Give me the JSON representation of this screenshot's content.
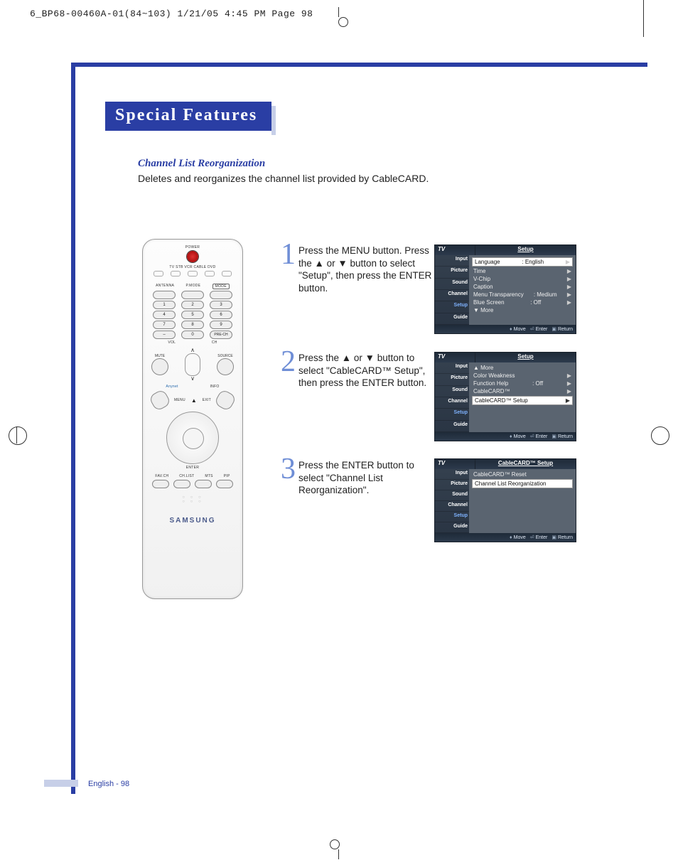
{
  "slug": "6_BP68-00460A-01(84~103)  1/21/05  4:45 PM  Page 98",
  "heading": "Special Features",
  "section_title": "Channel List Reorganization",
  "section_desc": "Deletes and reorganizes the channel list provided by CableCARD.",
  "remote": {
    "power": "POWER",
    "modes": "TV  STB  VCR  CABLE  DVD",
    "row_labels": [
      "ANTENNA",
      "P.MODE",
      "MODE"
    ],
    "num": [
      [
        "1",
        "2",
        "3"
      ],
      [
        "4",
        "5",
        "6"
      ],
      [
        "7",
        "8",
        "9"
      ],
      [
        "–",
        "0",
        "PRE-CH"
      ]
    ],
    "vol": "VOL",
    "ch": "CH",
    "mute": "MUTE",
    "source": "SOURCE",
    "info": "INFO",
    "menu": "MENU",
    "exit": "EXIT",
    "enter": "ENTER",
    "bottom": [
      "FAV.CH",
      "CH.LIST",
      "MTS",
      "PIP"
    ],
    "brand": "SAMSUNG"
  },
  "steps": {
    "s1": {
      "n": "1",
      "t": "Press the MENU button. Press the ▲ or ▼ button to select \"Setup\", then press the ENTER button."
    },
    "s2": {
      "n": "2",
      "t": "Press the ▲ or ▼ button to select \"CableCARD™ Setup\", then press the ENTER button."
    },
    "s3": {
      "n": "3",
      "t": "Press the ENTER button to select \"Channel List Reorganization\"."
    }
  },
  "osd_sidebar": [
    "Input",
    "Picture",
    "Sound",
    "Channel",
    "Setup",
    "Guide"
  ],
  "osd1": {
    "tv": "TV",
    "title": "Setup",
    "rows": [
      {
        "l": "Language",
        "v": ": English",
        "a": "▶",
        "hl": true
      },
      {
        "l": "Time",
        "v": "",
        "a": "▶"
      },
      {
        "l": "V-Chip",
        "v": "",
        "a": "▶"
      },
      {
        "l": "Caption",
        "v": "",
        "a": "▶"
      },
      {
        "l": "Menu Transparency",
        "v": ": Medium",
        "a": "▶"
      },
      {
        "l": "Blue Screen",
        "v": ": Off",
        "a": "▶"
      },
      {
        "l": "▼ More",
        "v": "",
        "a": ""
      }
    ]
  },
  "osd2": {
    "tv": "TV",
    "title": "Setup",
    "rows": [
      {
        "l": "▲ More",
        "v": "",
        "a": ""
      },
      {
        "l": "Color Weakness",
        "v": "",
        "a": "▶"
      },
      {
        "l": "Function Help",
        "v": ": Off",
        "a": "▶"
      },
      {
        "l": "CableCARD™",
        "v": "",
        "a": "▶"
      },
      {
        "l": "CableCARD™ Setup",
        "v": "",
        "a": "▶",
        "hl": true
      }
    ]
  },
  "osd3": {
    "tv": "TV",
    "title": "CableCARD™ Setup",
    "rows": [
      {
        "l": "CableCARD™ Reset",
        "v": "",
        "a": ""
      },
      {
        "l": "Channel List Reorganization",
        "v": "",
        "a": "",
        "hl": true
      }
    ]
  },
  "osd_foot": {
    "move": "Move",
    "enter": "Enter",
    "ret": "Return"
  },
  "footer": "English - 98"
}
